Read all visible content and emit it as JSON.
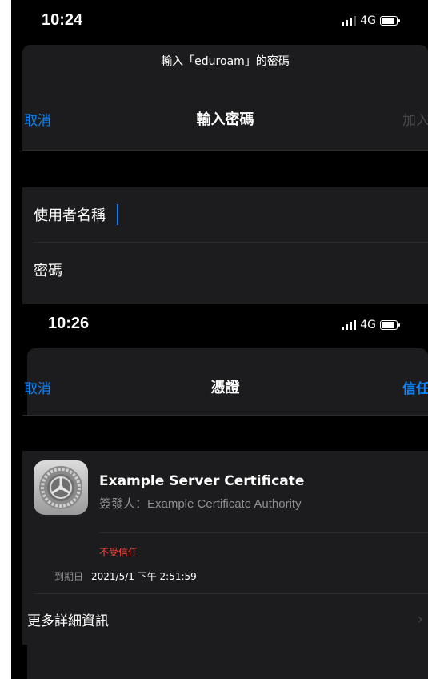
{
  "screen1": {
    "status": {
      "time": "10:24",
      "network": "4G"
    },
    "sheet_note": "輸入「eduroam」的密碼",
    "nav": {
      "cancel": "取消",
      "title": "輸入密碼",
      "join": "加入"
    },
    "fields": {
      "username_label": "使用者名稱",
      "password_label": "密碼"
    }
  },
  "screen2": {
    "status": {
      "time": "10:26",
      "network": "4G"
    },
    "nav": {
      "cancel": "取消",
      "title": "憑證",
      "trust": "信任"
    },
    "certificate": {
      "name": "Example Server Certificate",
      "issuer": "簽發人：Example Certificate Authority",
      "trust_status": "不受信任",
      "expires_label": "到期日",
      "expires_value": "2021/5/1 下午 2:51:59"
    },
    "more_details": "更多詳細資訊"
  },
  "colors": {
    "accent": "#0a84ff",
    "warning": "#ff453a",
    "sheet": "#1c1c1e"
  }
}
